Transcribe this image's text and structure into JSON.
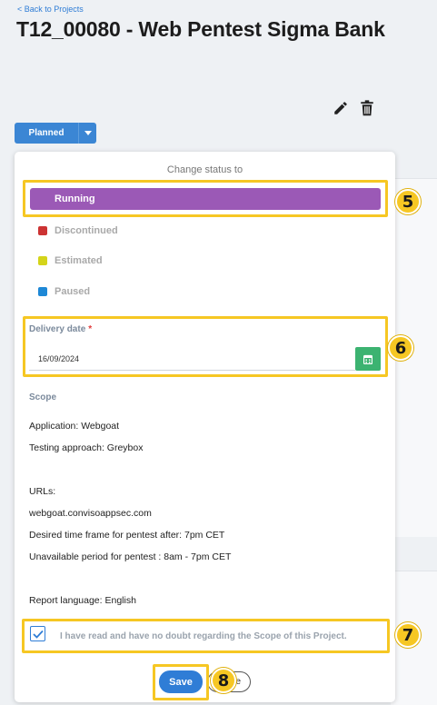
{
  "header": {
    "back_link": "< Back to Projects",
    "title": "T12_00080 - Web Pentest Sigma Bank"
  },
  "toolbar": {
    "edit_icon": "pencil-icon",
    "delete_icon": "trash-icon"
  },
  "status": {
    "current": "Planned",
    "caret_icon": "caret-down-icon"
  },
  "dropdown": {
    "title": "Change status to",
    "options": [
      {
        "label": "Running",
        "color": "#9b59b6",
        "selected": true
      },
      {
        "label": "Discontinued",
        "color": "#cc3333"
      },
      {
        "label": "Estimated",
        "color": "#d4d41a"
      },
      {
        "label": "Paused",
        "color": "#1e88d6"
      }
    ],
    "delivery": {
      "label": "Delivery date",
      "required_mark": "*",
      "value": "16/09/2024",
      "calendar_icon": "calendar-icon"
    },
    "scope": {
      "label": "Scope",
      "lines": [
        "Application: Webgoat",
        "Testing approach: Greybox",
        "URLs:",
        "webgoat.convisoappsec.com",
        "Desired time frame for pentest after: 7pm CET",
        "Unavailable period for pentest : 8am - 7pm CET",
        "Report language: English"
      ]
    },
    "acknowledge": {
      "checked": true,
      "text": "I have read and have no doubt regarding the Scope of this Project."
    },
    "buttons": {
      "save": "Save",
      "close_partial": "e"
    }
  },
  "annotations": {
    "badges": [
      "5",
      "6",
      "7",
      "8"
    ],
    "highlight_color": "#f6c723"
  }
}
